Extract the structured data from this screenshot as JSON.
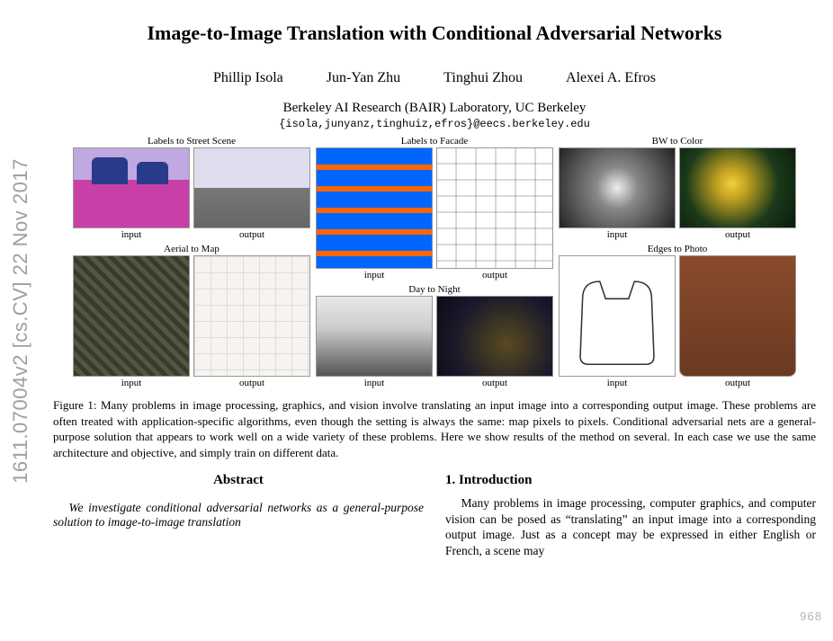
{
  "arxiv_id": "1611.07004v2  [cs.CV]  22 Nov 2017",
  "title": "Image-to-Image Translation with Conditional Adversarial Networks",
  "authors": [
    "Phillip Isola",
    "Jun-Yan Zhu",
    "Tinghui Zhou",
    "Alexei A. Efros"
  ],
  "affiliation": "Berkeley AI Research (BAIR) Laboratory, UC Berkeley",
  "email": "{isola,junyanz,tinghuiz,efros}@eecs.berkeley.edu",
  "figure1": {
    "examples": [
      {
        "title": "Labels to Street Scene",
        "input": "input",
        "output": "output"
      },
      {
        "title": "Aerial to Map",
        "input": "input",
        "output": "output"
      },
      {
        "title": "Labels to Facade",
        "input": "input",
        "output": "output"
      },
      {
        "title": "Day to Night",
        "input": "input",
        "output": "output"
      },
      {
        "title": "BW to Color",
        "input": "input",
        "output": "output"
      },
      {
        "title": "Edges to Photo",
        "input": "input",
        "output": "output"
      }
    ],
    "caption": "Figure 1: Many problems in image processing, graphics, and vision involve translating an input image into a corresponding output image. These problems are often treated with application-specific algorithms, even though the setting is always the same: map pixels to pixels. Conditional adversarial nets are a general-purpose solution that appears to work well on a wide variety of these problems. Here we show results of the method on several. In each case we use the same architecture and objective, and simply train on different data."
  },
  "abstract": {
    "heading": "Abstract",
    "body": "We investigate conditional adversarial networks as a general-purpose solution to image-to-image translation"
  },
  "intro": {
    "heading": "1. Introduction",
    "body": "Many problems in image processing, computer graphics, and computer vision can be posed as “translating” an input image into a corresponding output image. Just as a concept may be expressed in either English or French, a scene may"
  },
  "watermark": "968"
}
